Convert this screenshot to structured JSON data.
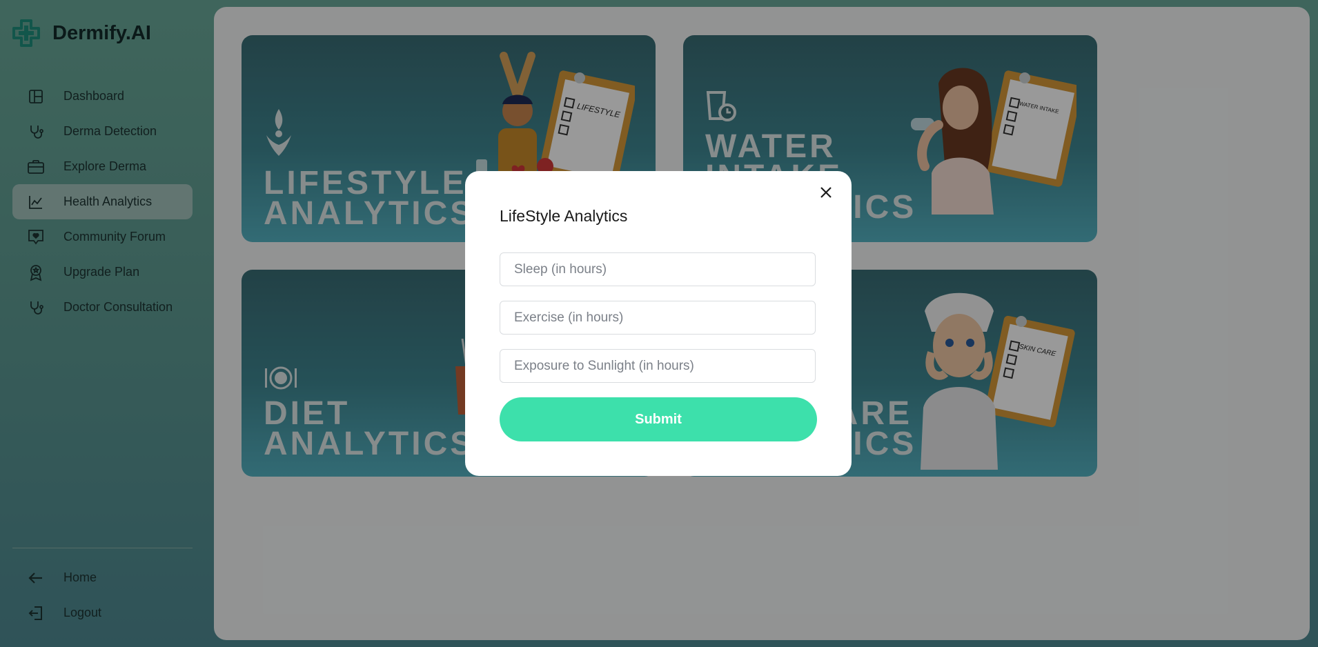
{
  "brand": {
    "name": "Dermify.AI",
    "accent": "#1f8f7e"
  },
  "sidebar": {
    "items": [
      {
        "label": "Dashboard",
        "icon": "layout-icon"
      },
      {
        "label": "Derma Detection",
        "icon": "stethoscope-icon"
      },
      {
        "label": "Explore Derma",
        "icon": "briefcase-icon"
      },
      {
        "label": "Health Analytics",
        "icon": "chart-line-icon",
        "active": true
      },
      {
        "label": "Community Forum",
        "icon": "heart-message-icon"
      },
      {
        "label": "Upgrade Plan",
        "icon": "award-icon"
      },
      {
        "label": "Doctor Consultation",
        "icon": "stethoscope-icon"
      }
    ],
    "bottom": [
      {
        "label": "Home",
        "icon": "arrow-left-icon"
      },
      {
        "label": "Logout",
        "icon": "logout-icon"
      }
    ]
  },
  "cards": [
    {
      "title": "LIFESTYLE\nANALYTICS",
      "art_text": "LIFESTYLE"
    },
    {
      "title": "WATER\nINTAKE\nANALYTICS",
      "art_text": "WATER INTAKE"
    },
    {
      "title": "DIET\nANALYTICS",
      "art_text": ""
    },
    {
      "title": "SKIN CARE\nANALYTICS",
      "art_text": "SKIN CARE"
    }
  ],
  "modal": {
    "title": "LifeStyle Analytics",
    "fields": [
      {
        "placeholder": "Sleep (in hours)",
        "value": ""
      },
      {
        "placeholder": "Exercise (in hours)",
        "value": ""
      },
      {
        "placeholder": "Exposure to Sunlight (in hours)",
        "value": ""
      }
    ],
    "submit_label": "Submit",
    "submit_color": "#3de0ab"
  }
}
